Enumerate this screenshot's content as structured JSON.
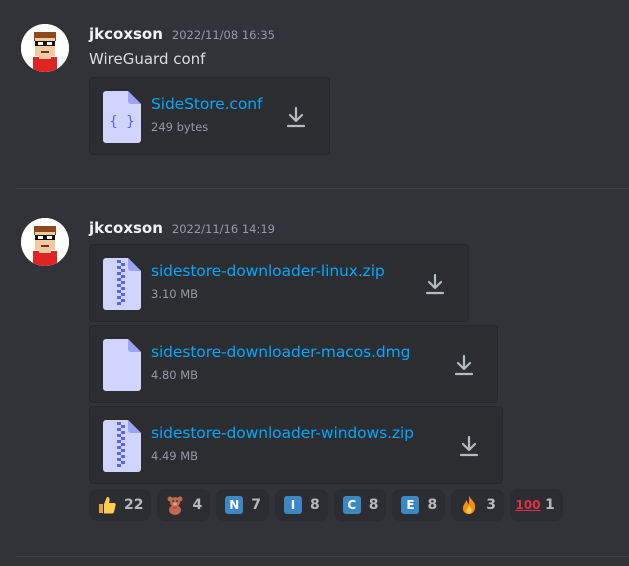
{
  "messages": [
    {
      "username": "jkcoxson",
      "timestamp": "2022/11/08 16:35",
      "text": "WireGuard conf",
      "attachments": [
        {
          "name": "SideStore.conf",
          "size": "249 bytes",
          "type": "code"
        }
      ]
    },
    {
      "username": "jkcoxson",
      "timestamp": "2022/11/16 14:19",
      "attachments": [
        {
          "name": "sidestore-downloader-linux.zip",
          "size": "3.10 MB",
          "type": "zip"
        },
        {
          "name": "sidestore-downloader-macos.dmg",
          "size": "4.80 MB",
          "type": "file"
        },
        {
          "name": "sidestore-downloader-windows.zip",
          "size": "4.49 MB",
          "type": "zip"
        }
      ],
      "reactions": [
        {
          "emoji": "thumbs-up",
          "count": "22"
        },
        {
          "emoji": "teddy-bear",
          "count": "4"
        },
        {
          "emoji": "regional-n",
          "letter": "N",
          "count": "7"
        },
        {
          "emoji": "regional-i",
          "letter": "I",
          "count": "8"
        },
        {
          "emoji": "regional-c",
          "letter": "C",
          "count": "8"
        },
        {
          "emoji": "regional-e",
          "letter": "E",
          "count": "8"
        },
        {
          "emoji": "fire",
          "count": "3"
        },
        {
          "emoji": "hundred-points",
          "label": "100",
          "count": "1"
        }
      ]
    }
  ],
  "colors": {
    "background": "#313338",
    "link": "#00a8fc",
    "attachment_bg": "#2b2d31",
    "file_icon": "#d0d4ff",
    "file_icon_accent": "#5865f2"
  }
}
